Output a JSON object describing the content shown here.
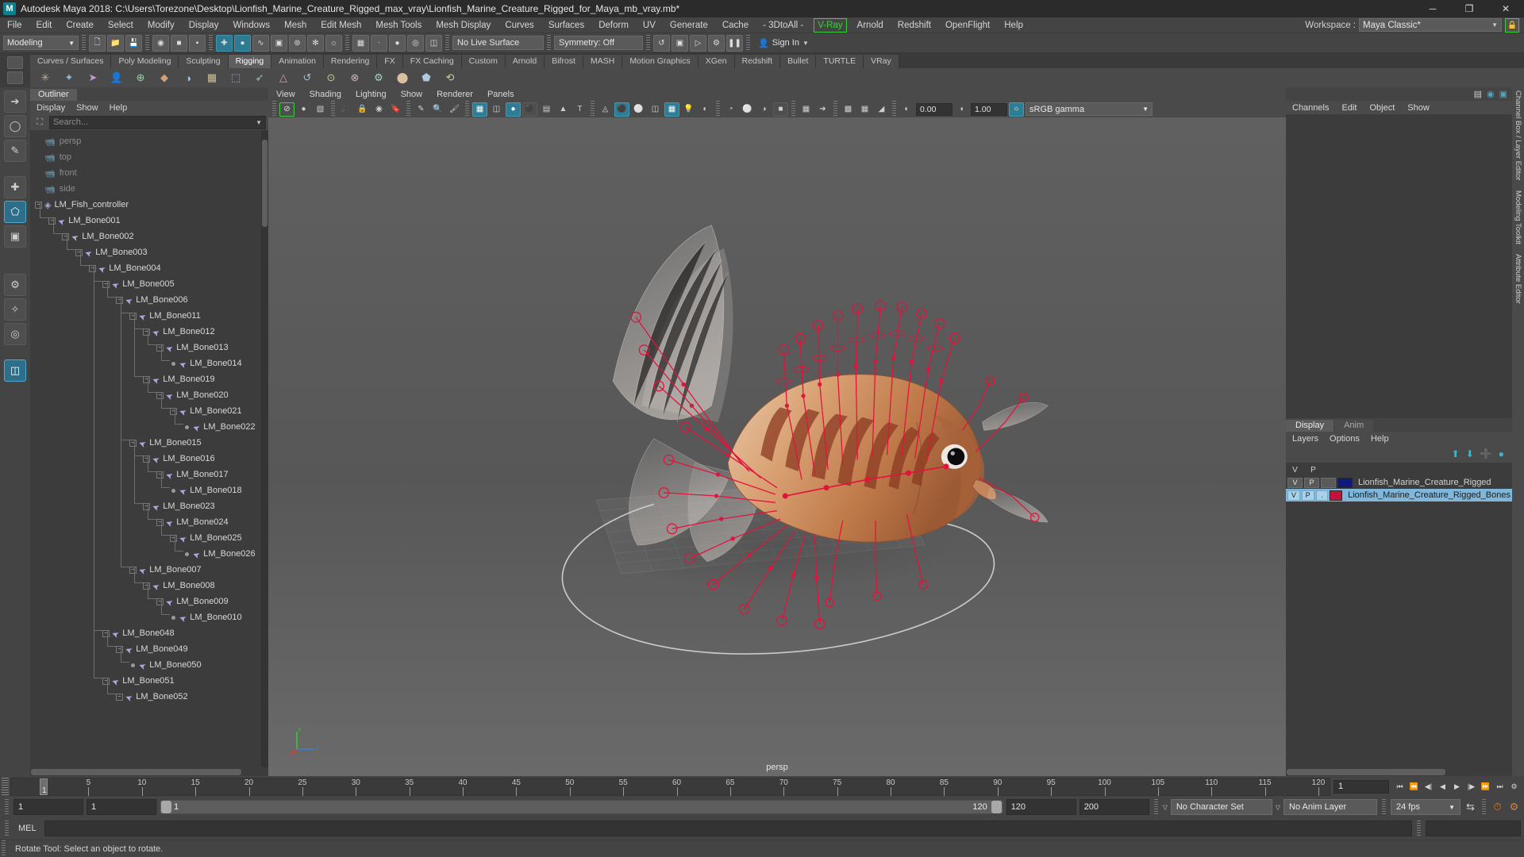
{
  "window": {
    "title": "Autodesk Maya 2018: C:\\Users\\Torezone\\Desktop\\Lionfish_Marine_Creature_Rigged_max_vray\\Lionfish_Marine_Creature_Rigged_for_Maya_mb_vray.mb*",
    "logo": "M",
    "minimize": "─",
    "maximize": "❐",
    "close": "✕"
  },
  "menubar": {
    "items": [
      "File",
      "Edit",
      "Create",
      "Select",
      "Modify",
      "Display",
      "Windows",
      "Mesh",
      "Edit Mesh",
      "Mesh Tools",
      "Mesh Display",
      "Curves",
      "Surfaces",
      "Deform",
      "UV",
      "Generate",
      "Cache",
      "- 3DtoAll -"
    ],
    "vray": "V-Ray",
    "items_after": [
      "Arnold",
      "Redshift",
      "OpenFlight",
      "Help"
    ],
    "workspace_label": "Workspace :",
    "workspace_value": "Maya Classic*",
    "workspace_arrow": "▼",
    "lock_icon": "🔒"
  },
  "statusline": {
    "mode": "Modeling",
    "mode_arrow": "▼",
    "no_live_surface": "No Live Surface",
    "symmetry": "Symmetry: Off",
    "signin": "Sign In",
    "signin_arrow": "▼"
  },
  "shelf": {
    "tabs": [
      "Curves / Surfaces",
      "Poly Modeling",
      "Sculpting",
      "Rigging",
      "Animation",
      "Rendering",
      "FX",
      "FX Caching",
      "Custom",
      "Arnold",
      "Bifrost",
      "MASH",
      "Motion Graphics",
      "XGen",
      "Redshift",
      "Bullet",
      "TURTLE",
      "VRay"
    ],
    "active": "Rigging",
    "icons": [
      "✳",
      "✦",
      "➤",
      "👤",
      "⊕",
      "◆",
      "◑",
      "▦",
      "⬚",
      "➶",
      "△",
      "↺",
      "⊙",
      "⊗",
      "⚙",
      "⬤",
      "⬟",
      "⟲"
    ]
  },
  "toolbox": {
    "tools": [
      "select-arrow",
      "lasso-select",
      "paint-select",
      "move-tool",
      "rotate-tool",
      "scale-tool",
      "last-tool",
      "soft-mod",
      "show-manip"
    ]
  },
  "outliner": {
    "tab": "Outliner",
    "menu": [
      "Display",
      "Show",
      "Help"
    ],
    "search_placeholder": "Search...",
    "search_arrow": "▼",
    "tree": [
      {
        "label": "persp",
        "depth": 1,
        "icon": "camera",
        "dim": true,
        "box": "none"
      },
      {
        "label": "top",
        "depth": 1,
        "icon": "camera",
        "dim": true,
        "box": "none"
      },
      {
        "label": "front",
        "depth": 1,
        "icon": "camera",
        "dim": true,
        "box": "none"
      },
      {
        "label": "side",
        "depth": 1,
        "icon": "camera",
        "dim": true,
        "box": "none"
      },
      {
        "label": "LM_Fish_controller",
        "depth": 1,
        "icon": "controller",
        "dim": false,
        "box": "minus"
      },
      {
        "label": "LM_Bone001",
        "depth": 2,
        "icon": "bone",
        "dim": false,
        "box": "minus"
      },
      {
        "label": "LM_Bone002",
        "depth": 3,
        "icon": "bone",
        "dim": false,
        "box": "minus"
      },
      {
        "label": "LM_Bone003",
        "depth": 4,
        "icon": "bone",
        "dim": false,
        "box": "minus"
      },
      {
        "label": "LM_Bone004",
        "depth": 5,
        "icon": "bone",
        "dim": false,
        "box": "minus"
      },
      {
        "label": "LM_Bone005",
        "depth": 6,
        "icon": "bone",
        "dim": false,
        "box": "minus"
      },
      {
        "label": "LM_Bone006",
        "depth": 7,
        "icon": "bone",
        "dim": false,
        "box": "minus"
      },
      {
        "label": "LM_Bone011",
        "depth": 8,
        "icon": "bone",
        "dim": false,
        "box": "minus"
      },
      {
        "label": "LM_Bone012",
        "depth": 9,
        "icon": "bone",
        "dim": false,
        "box": "minus"
      },
      {
        "label": "LM_Bone013",
        "depth": 10,
        "icon": "bone",
        "dim": false,
        "box": "minus"
      },
      {
        "label": "LM_Bone014",
        "depth": 11,
        "icon": "bone",
        "dim": false,
        "box": "dot"
      },
      {
        "label": "LM_Bone019",
        "depth": 9,
        "icon": "bone",
        "dim": false,
        "box": "minus"
      },
      {
        "label": "LM_Bone020",
        "depth": 10,
        "icon": "bone",
        "dim": false,
        "box": "minus"
      },
      {
        "label": "LM_Bone021",
        "depth": 11,
        "icon": "bone",
        "dim": false,
        "box": "minus"
      },
      {
        "label": "LM_Bone022",
        "depth": 12,
        "icon": "bone",
        "dim": false,
        "box": "dot"
      },
      {
        "label": "LM_Bone015",
        "depth": 8,
        "icon": "bone",
        "dim": false,
        "box": "minus"
      },
      {
        "label": "LM_Bone016",
        "depth": 9,
        "icon": "bone",
        "dim": false,
        "box": "minus"
      },
      {
        "label": "LM_Bone017",
        "depth": 10,
        "icon": "bone",
        "dim": false,
        "box": "minus"
      },
      {
        "label": "LM_Bone018",
        "depth": 11,
        "icon": "bone",
        "dim": false,
        "box": "dot"
      },
      {
        "label": "LM_Bone023",
        "depth": 9,
        "icon": "bone",
        "dim": false,
        "box": "minus"
      },
      {
        "label": "LM_Bone024",
        "depth": 10,
        "icon": "bone",
        "dim": false,
        "box": "minus"
      },
      {
        "label": "LM_Bone025",
        "depth": 11,
        "icon": "bone",
        "dim": false,
        "box": "minus"
      },
      {
        "label": "LM_Bone026",
        "depth": 12,
        "icon": "bone",
        "dim": false,
        "box": "dot"
      },
      {
        "label": "LM_Bone007",
        "depth": 8,
        "icon": "bone",
        "dim": false,
        "box": "minus"
      },
      {
        "label": "LM_Bone008",
        "depth": 9,
        "icon": "bone",
        "dim": false,
        "box": "minus"
      },
      {
        "label": "LM_Bone009",
        "depth": 10,
        "icon": "bone",
        "dim": false,
        "box": "minus"
      },
      {
        "label": "LM_Bone010",
        "depth": 11,
        "icon": "bone",
        "dim": false,
        "box": "dot"
      },
      {
        "label": "LM_Bone048",
        "depth": 6,
        "icon": "bone",
        "dim": false,
        "box": "minus"
      },
      {
        "label": "LM_Bone049",
        "depth": 7,
        "icon": "bone",
        "dim": false,
        "box": "minus"
      },
      {
        "label": "LM_Bone050",
        "depth": 8,
        "icon": "bone",
        "dim": false,
        "box": "dot"
      },
      {
        "label": "LM_Bone051",
        "depth": 6,
        "icon": "bone",
        "dim": false,
        "box": "minus"
      },
      {
        "label": "LM_Bone052",
        "depth": 7,
        "icon": "bone",
        "dim": false,
        "box": "minus"
      }
    ]
  },
  "viewport": {
    "menu": [
      "View",
      "Shading",
      "Lighting",
      "Show",
      "Renderer",
      "Panels"
    ],
    "exposure": "0.00",
    "gamma_value": "1.00",
    "color_profile": "sRGB gamma",
    "profile_arrow": "▼",
    "camera_label": "persp",
    "axis_labels": {
      "x": "x",
      "y": "y",
      "z": "z"
    }
  },
  "channelbox": {
    "menu": [
      "Channels",
      "Edit",
      "Object",
      "Show"
    ],
    "vtabs": [
      "Channel Box / Layer Editor",
      "Modeling Toolkit",
      "Attribute Editor"
    ]
  },
  "layer_editor": {
    "tabs": [
      "Display",
      "Anim"
    ],
    "active_tab": "Display",
    "menu": [
      "Layers",
      "Options",
      "Help"
    ],
    "toolbar_icons": [
      "move-layer-up",
      "move-layer-down",
      "new-layer",
      "new-layer-from-selected"
    ],
    "columns": {
      "visibility": "V",
      "playback": "P"
    },
    "layers": [
      {
        "v": "V",
        "p": "P",
        "t": "",
        "color": "#101a7a",
        "name": "Lionfish_Marine_Creature_Rigged",
        "selected": false
      },
      {
        "v": "V",
        "p": "P",
        "t": "",
        "color": "#c4123f",
        "name": "Lionfish_Marine_Creature_Rigged_Bones",
        "selected": true
      }
    ]
  },
  "timeline": {
    "ticks": [
      5,
      10,
      15,
      20,
      25,
      30,
      35,
      40,
      45,
      50,
      55,
      60,
      65,
      70,
      75,
      80,
      85,
      90,
      95,
      100,
      105,
      110,
      115,
      120
    ],
    "current_frame": "1",
    "frame_field": "1",
    "playback_buttons": [
      "go-to-start",
      "step-back-key",
      "step-back",
      "play-backwards",
      "play-forwards",
      "step-forward",
      "step-forward-key",
      "go-to-end"
    ]
  },
  "range": {
    "anim_start": "1",
    "range_start": "1",
    "slider_min": "1",
    "slider_max": "120",
    "range_end": "120",
    "anim_end": "200",
    "character_set": "No Character Set",
    "anim_layer": "No Anim Layer",
    "fps": "24 fps",
    "fps_arrow": "▼"
  },
  "command": {
    "language": "MEL",
    "input_value": ""
  },
  "helpline": {
    "text": "Rotate Tool: Select an object to rotate."
  }
}
